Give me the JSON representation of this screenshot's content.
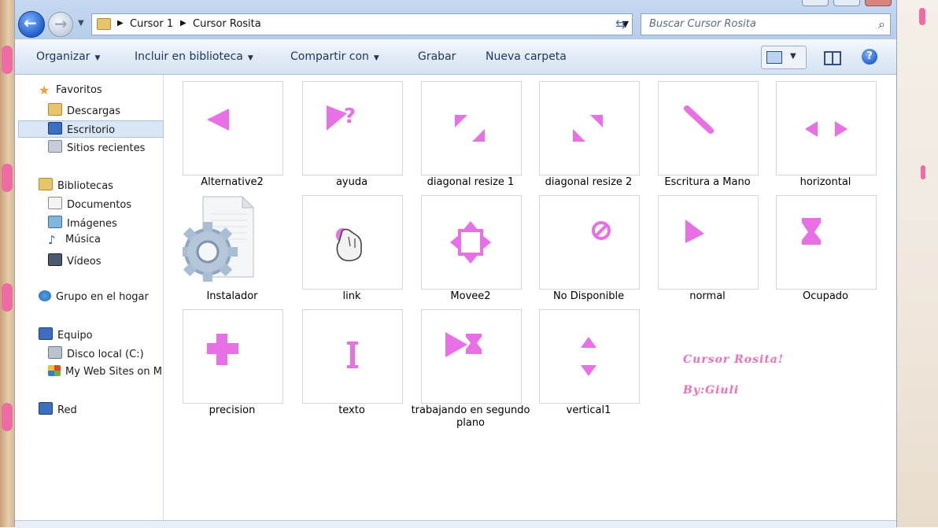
{
  "breadcrumb": [
    "Cursor 1",
    "Cursor Rosita"
  ],
  "search": {
    "placeholder": "Buscar Cursor Rosita"
  },
  "toolbar": {
    "organize": "Organizar",
    "include": "Incluir en biblioteca",
    "share": "Compartir con",
    "burn": "Grabar",
    "new_folder": "Nueva carpeta"
  },
  "nav": {
    "favorites": "Favoritos",
    "downloads": "Descargas",
    "desktop": "Escritorio",
    "recent": "Sitios recientes",
    "libraries": "Bibliotecas",
    "documents": "Documentos",
    "images": "Imágenes",
    "music": "Música",
    "videos": "Vídeos",
    "homegroup": "Grupo en el hogar",
    "computer": "Equipo",
    "local_disk": "Disco local (C:)",
    "websites": "My Web Sites on M",
    "network": "Red"
  },
  "files": [
    {
      "name": "Alternative2",
      "icon": "cursor-alternate"
    },
    {
      "name": "ayuda",
      "icon": "cursor-help"
    },
    {
      "name": "diagonal resize 1",
      "icon": "cursor-resize-nwse"
    },
    {
      "name": "diagonal resize 2",
      "icon": "cursor-resize-nesw"
    },
    {
      "name": "Escritura a Mano",
      "icon": "cursor-handwriting"
    },
    {
      "name": "horizontal",
      "icon": "cursor-resize-horizontal"
    },
    {
      "name": "Instalador",
      "icon": "installer-gear"
    },
    {
      "name": "link",
      "icon": "cursor-link-hand"
    },
    {
      "name": "Movee2",
      "icon": "cursor-move"
    },
    {
      "name": "No Disponible",
      "icon": "cursor-unavailable"
    },
    {
      "name": "normal",
      "icon": "cursor-arrow"
    },
    {
      "name": "Ocupado",
      "icon": "cursor-busy"
    },
    {
      "name": "precision",
      "icon": "cursor-precision"
    },
    {
      "name": "texto",
      "icon": "cursor-text"
    },
    {
      "name": "trabajando en segundo plano",
      "icon": "cursor-working"
    },
    {
      "name": "vertical1",
      "icon": "cursor-resize-vertical"
    }
  ],
  "credits": {
    "line1": "Cursor Rosita!",
    "line2": "By:Giuli"
  },
  "colors": {
    "cursor_pink": "#e86fe6",
    "title_blue": "#b6cde9",
    "credit_pink": "#f070b8"
  }
}
